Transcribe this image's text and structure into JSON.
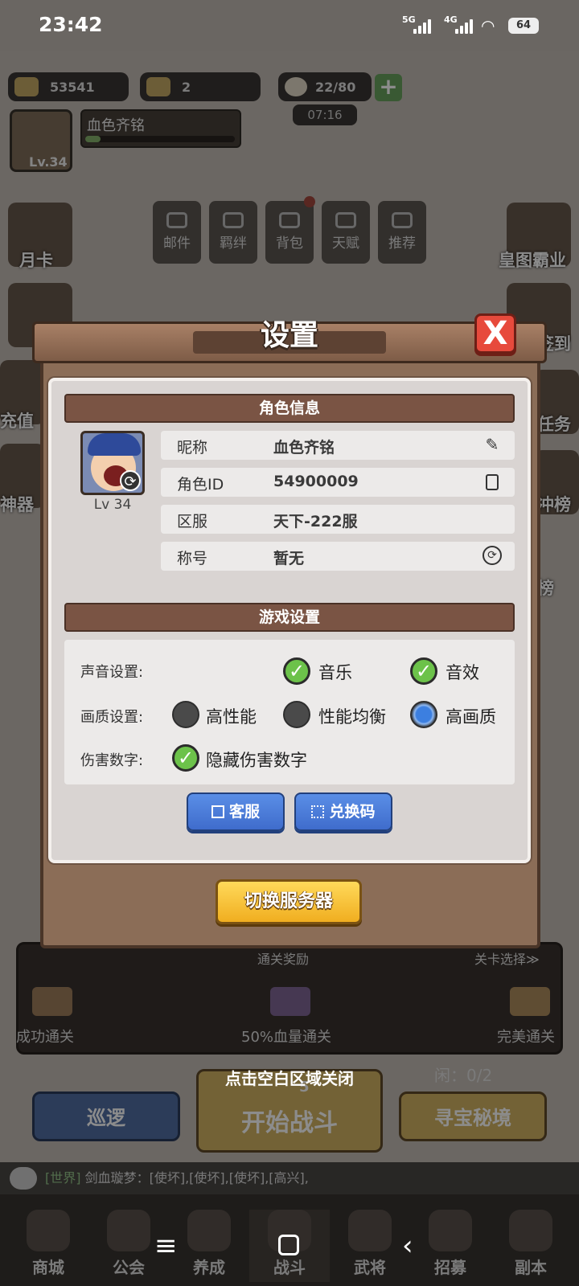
{
  "status": {
    "time": "23:42",
    "net1": "5G",
    "net2": "4G",
    "battery": "64"
  },
  "top": {
    "gold": "53541",
    "ticket": "2",
    "stamina": "22/80",
    "timer": "07:16",
    "player_name": "血色齐铭",
    "player_level": "Lv.34"
  },
  "menu": [
    "邮件",
    "羁绊",
    "背包",
    "天赋",
    "推荐"
  ],
  "side_left": [
    "月卡",
    "充值",
    "神器"
  ],
  "side_right": [
    "皇图霸业",
    "签到",
    "任务",
    "冲榜",
    "榜"
  ],
  "reward": {
    "title": "通关奖励",
    "link": "关卡选择≫",
    "items": [
      "成功通关",
      "50%血量通关",
      "完美通关"
    ]
  },
  "battle": {
    "patrol": "巡逻",
    "start": "开始战斗",
    "treasure": "寻宝秘境",
    "idle": "闲：0/2",
    "cost": "5"
  },
  "chat": {
    "channel": "[世界]",
    "text": "剑血璇梦：[使坏],[使坏],[使坏],[高兴],"
  },
  "nav": [
    "商城",
    "公会",
    "养成",
    "战斗",
    "武将",
    "招募",
    "副本"
  ],
  "dialog": {
    "title": "设置",
    "close": "X",
    "role_header": "角色信息",
    "avatar_level": "Lv 34",
    "rows": [
      {
        "key": "昵称",
        "value": "血色齐铭"
      },
      {
        "key": "角色ID",
        "value": "54900009"
      },
      {
        "key": "区服",
        "value": "天下-222服"
      },
      {
        "key": "称号",
        "value": "暂无"
      }
    ],
    "game_header": "游戏设置",
    "sound_label": "声音设置:",
    "music": "音乐",
    "sfx": "音效",
    "quality_label": "画质设置:",
    "q_high_perf": "高性能",
    "q_balanced": "性能均衡",
    "q_high_quality": "高画质",
    "damage_label": "伤害数字:",
    "hide_damage": "隐藏伤害数字",
    "support": "客服",
    "redeem": "兑换码",
    "switch_server": "切换服务器"
  },
  "close_hint": "点击空白区域关闭"
}
